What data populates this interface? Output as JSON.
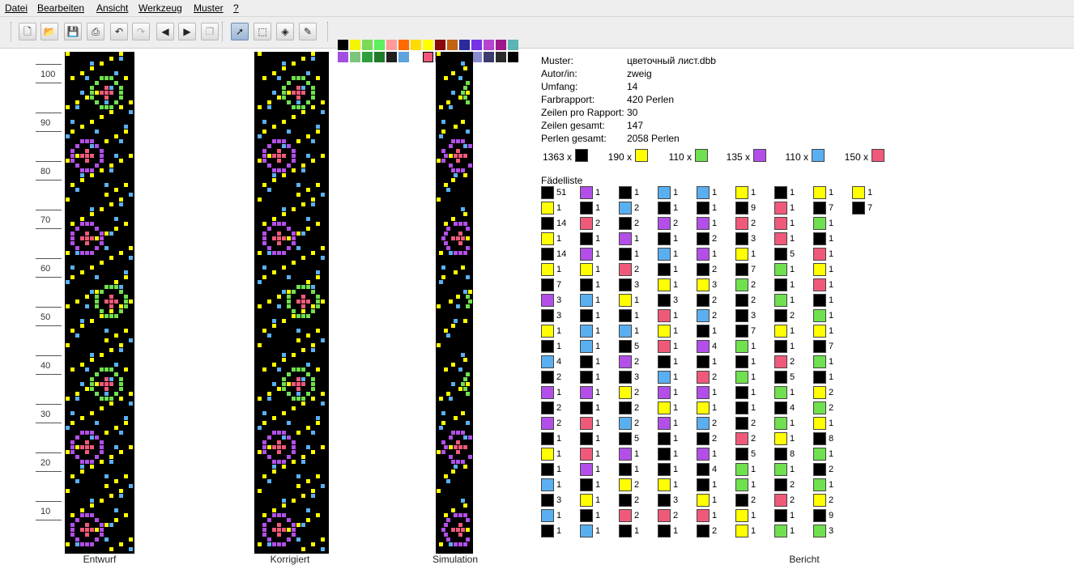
{
  "menu": [
    "Datei",
    "Bearbeiten",
    "Ansicht",
    "Werkzeug",
    "Muster",
    "?"
  ],
  "toolbar": {
    "buttons": [
      {
        "name": "new-file-button",
        "icon": "new-document-icon",
        "glyph": "🗋"
      },
      {
        "name": "open-file-button",
        "icon": "folder-open-icon",
        "glyph": "📂"
      },
      {
        "name": "save-button",
        "icon": "save-icon",
        "glyph": "💾"
      },
      {
        "name": "print-button",
        "icon": "printer-icon",
        "glyph": "⎙"
      },
      {
        "name": "undo-button",
        "icon": "undo-icon",
        "glyph": "↶"
      },
      {
        "name": "redo-button",
        "icon": "redo-icon",
        "glyph": "↷"
      },
      {
        "name": "arrow-left-button",
        "icon": "arrow-left-icon",
        "glyph": "◀"
      },
      {
        "name": "arrow-right-button",
        "icon": "arrow-right-icon",
        "glyph": "▶"
      },
      {
        "name": "copy-button",
        "icon": "copy-icon",
        "glyph": "❐"
      },
      {
        "name": "pointer-tool-button",
        "icon": "pointer-icon",
        "glyph": "➚"
      },
      {
        "name": "select-tool-button",
        "icon": "selection-rectangle-icon",
        "glyph": "⬚"
      },
      {
        "name": "fill-tool-button",
        "icon": "paint-bucket-icon",
        "glyph": "◈"
      },
      {
        "name": "pipette-tool-button",
        "icon": "eyedropper-icon",
        "glyph": "✎"
      }
    ],
    "palette_row1": [
      "#000000",
      "#f5f500",
      "#7cd957",
      "#5ef05e",
      "#ff9b9b",
      "#ff6b00",
      "#ffdc00",
      "#ffff00",
      "#8b0a0a",
      "#c36412",
      "#2b2b9c",
      "#7732e6",
      "#b545d1",
      "#9e1a8a",
      "#5db4b4"
    ],
    "palette_row2": [
      "#a24ee0",
      "#7bc67b",
      "#2e9e3c",
      "#1f7a2a",
      "#1f1f1f",
      "#5ea2de",
      "#ffffff",
      "#f05a78",
      "#b49ae8",
      "#f4b9ee",
      "#d9d9d9",
      "#8a8ad0",
      "#3c3c6e",
      "#2b2b2b",
      "#000000"
    ],
    "selected_palette_index_row2": 7
  },
  "ruler": {
    "labels": [
      "100",
      "90",
      "80",
      "70",
      "60",
      "50",
      "40",
      "30",
      "20",
      "10"
    ]
  },
  "views": {
    "entwurf": "Entwurf",
    "korrigiert": "Korrigiert",
    "simulation": "Simulation",
    "bericht": "Bericht"
  },
  "colors": {
    "k": "#000000",
    "y": "#ffff00",
    "g": "#6fe04f",
    "p": "#b34fe8",
    "b": "#5aaff0",
    "r": "#f05a7a"
  },
  "info": [
    {
      "label": "Muster:",
      "value": "цветочный лист.dbb"
    },
    {
      "label": "Autor/in:",
      "value": "zweig"
    },
    {
      "label": "Umfang:",
      "value": "14"
    },
    {
      "label": "Farbrapport:",
      "value": "420 Perlen"
    },
    {
      "label": "Zeilen pro Rapport:",
      "value": "30"
    },
    {
      "label": "Zeilen gesamt:",
      "value": "147"
    },
    {
      "label": "Perlen gesamt:",
      "value": "2058 Perlen"
    }
  ],
  "totals": [
    {
      "count": "1363 x",
      "color": "k"
    },
    {
      "count": "190 x",
      "color": "y"
    },
    {
      "count": "110 x",
      "color": "g"
    },
    {
      "count": "135 x",
      "color": "p"
    },
    {
      "count": "110 x",
      "color": "b"
    },
    {
      "count": "150 x",
      "color": "r"
    }
  ],
  "faedelliste_title": "Fädelliste",
  "faedelliste": [
    [
      [
        "k",
        "51"
      ],
      [
        "y",
        "1"
      ],
      [
        "k",
        "14"
      ],
      [
        "y",
        "1"
      ],
      [
        "k",
        "14"
      ],
      [
        "y",
        "1"
      ],
      [
        "k",
        "7"
      ],
      [
        "p",
        "3"
      ],
      [
        "k",
        "3"
      ],
      [
        "y",
        "1"
      ],
      [
        "k",
        "1"
      ],
      [
        "b",
        "4"
      ],
      [
        "k",
        "2"
      ],
      [
        "p",
        "1"
      ],
      [
        "k",
        "2"
      ],
      [
        "p",
        "2"
      ],
      [
        "k",
        "1"
      ],
      [
        "y",
        "1"
      ],
      [
        "k",
        "1"
      ],
      [
        "b",
        "1"
      ],
      [
        "k",
        "3"
      ],
      [
        "b",
        "1"
      ],
      [
        "k",
        "1"
      ]
    ],
    [
      [
        "p",
        "1"
      ],
      [
        "k",
        "1"
      ],
      [
        "r",
        "2"
      ],
      [
        "k",
        "1"
      ],
      [
        "p",
        "1"
      ],
      [
        "y",
        "1"
      ],
      [
        "k",
        "1"
      ],
      [
        "b",
        "1"
      ],
      [
        "k",
        "1"
      ],
      [
        "b",
        "1"
      ],
      [
        "b",
        "1"
      ],
      [
        "k",
        "1"
      ],
      [
        "k",
        "1"
      ],
      [
        "p",
        "1"
      ],
      [
        "k",
        "1"
      ],
      [
        "r",
        "1"
      ],
      [
        "k",
        "1"
      ],
      [
        "r",
        "1"
      ],
      [
        "p",
        "1"
      ],
      [
        "k",
        "1"
      ],
      [
        "y",
        "1"
      ],
      [
        "k",
        "1"
      ],
      [
        "b",
        "1"
      ]
    ],
    [
      [
        "k",
        "1"
      ],
      [
        "b",
        "2"
      ],
      [
        "k",
        "2"
      ],
      [
        "p",
        "1"
      ],
      [
        "k",
        "1"
      ],
      [
        "r",
        "2"
      ],
      [
        "k",
        "3"
      ],
      [
        "y",
        "1"
      ],
      [
        "k",
        "1"
      ],
      [
        "b",
        "1"
      ],
      [
        "k",
        "5"
      ],
      [
        "p",
        "2"
      ],
      [
        "k",
        "3"
      ],
      [
        "y",
        "2"
      ],
      [
        "k",
        "2"
      ],
      [
        "b",
        "2"
      ],
      [
        "k",
        "5"
      ],
      [
        "p",
        "1"
      ],
      [
        "k",
        "1"
      ],
      [
        "y",
        "2"
      ],
      [
        "k",
        "2"
      ],
      [
        "r",
        "2"
      ],
      [
        "k",
        "1"
      ]
    ],
    [
      [
        "b",
        "1"
      ],
      [
        "k",
        "1"
      ],
      [
        "p",
        "2"
      ],
      [
        "k",
        "1"
      ],
      [
        "b",
        "1"
      ],
      [
        "k",
        "1"
      ],
      [
        "y",
        "1"
      ],
      [
        "k",
        "3"
      ],
      [
        "r",
        "1"
      ],
      [
        "y",
        "1"
      ],
      [
        "r",
        "1"
      ],
      [
        "k",
        "1"
      ],
      [
        "b",
        "1"
      ],
      [
        "p",
        "1"
      ],
      [
        "y",
        "1"
      ],
      [
        "p",
        "1"
      ],
      [
        "k",
        "1"
      ],
      [
        "k",
        "1"
      ],
      [
        "k",
        "1"
      ],
      [
        "y",
        "1"
      ],
      [
        "k",
        "3"
      ],
      [
        "r",
        "2"
      ],
      [
        "k",
        "1"
      ]
    ],
    [
      [
        "b",
        "1"
      ],
      [
        "k",
        "1"
      ],
      [
        "p",
        "1"
      ],
      [
        "k",
        "2"
      ],
      [
        "p",
        "1"
      ],
      [
        "k",
        "2"
      ],
      [
        "y",
        "3"
      ],
      [
        "k",
        "2"
      ],
      [
        "b",
        "2"
      ],
      [
        "k",
        "1"
      ],
      [
        "p",
        "4"
      ],
      [
        "k",
        "1"
      ],
      [
        "r",
        "2"
      ],
      [
        "p",
        "1"
      ],
      [
        "y",
        "1"
      ],
      [
        "b",
        "2"
      ],
      [
        "k",
        "2"
      ],
      [
        "p",
        "1"
      ],
      [
        "k",
        "4"
      ],
      [
        "k",
        "1"
      ],
      [
        "y",
        "1"
      ],
      [
        "r",
        "1"
      ],
      [
        "k",
        "2"
      ]
    ],
    [
      [
        "y",
        "1"
      ],
      [
        "k",
        "9"
      ],
      [
        "r",
        "2"
      ],
      [
        "k",
        "3"
      ],
      [
        "y",
        "1"
      ],
      [
        "k",
        "7"
      ],
      [
        "g",
        "2"
      ],
      [
        "k",
        "2"
      ],
      [
        "k",
        "3"
      ],
      [
        "k",
        "7"
      ],
      [
        "g",
        "1"
      ],
      [
        "k",
        "1"
      ],
      [
        "g",
        "1"
      ],
      [
        "k",
        "1"
      ],
      [
        "k",
        "1"
      ],
      [
        "k",
        "2"
      ],
      [
        "r",
        "2"
      ],
      [
        "k",
        "5"
      ],
      [
        "g",
        "1"
      ],
      [
        "g",
        "1"
      ],
      [
        "k",
        "2"
      ],
      [
        "y",
        "1"
      ],
      [
        "y",
        "1"
      ]
    ],
    [
      [
        "k",
        "1"
      ],
      [
        "r",
        "1"
      ],
      [
        "r",
        "1"
      ],
      [
        "r",
        "1"
      ],
      [
        "k",
        "5"
      ],
      [
        "g",
        "1"
      ],
      [
        "k",
        "1"
      ],
      [
        "g",
        "1"
      ],
      [
        "k",
        "2"
      ],
      [
        "y",
        "1"
      ],
      [
        "k",
        "1"
      ],
      [
        "r",
        "2"
      ],
      [
        "k",
        "5"
      ],
      [
        "g",
        "1"
      ],
      [
        "k",
        "4"
      ],
      [
        "g",
        "1"
      ],
      [
        "y",
        "1"
      ],
      [
        "k",
        "8"
      ],
      [
        "g",
        "1"
      ],
      [
        "k",
        "2"
      ],
      [
        "r",
        "2"
      ],
      [
        "k",
        "1"
      ],
      [
        "g",
        "1"
      ]
    ],
    [
      [
        "y",
        "1"
      ],
      [
        "k",
        "7"
      ],
      [
        "g",
        "1"
      ],
      [
        "k",
        "1"
      ],
      [
        "r",
        "1"
      ],
      [
        "y",
        "1"
      ],
      [
        "r",
        "1"
      ],
      [
        "k",
        "1"
      ],
      [
        "g",
        "1"
      ],
      [
        "y",
        "1"
      ],
      [
        "k",
        "7"
      ],
      [
        "g",
        "1"
      ],
      [
        "k",
        "1"
      ],
      [
        "y",
        "2"
      ],
      [
        "g",
        "2"
      ],
      [
        "y",
        "1"
      ],
      [
        "k",
        "8"
      ],
      [
        "g",
        "1"
      ],
      [
        "k",
        "2"
      ],
      [
        "g",
        "1"
      ],
      [
        "y",
        "2"
      ],
      [
        "k",
        "9"
      ],
      [
        "g",
        "3"
      ]
    ],
    [
      [
        "y",
        "1"
      ],
      [
        "k",
        "7"
      ]
    ]
  ]
}
